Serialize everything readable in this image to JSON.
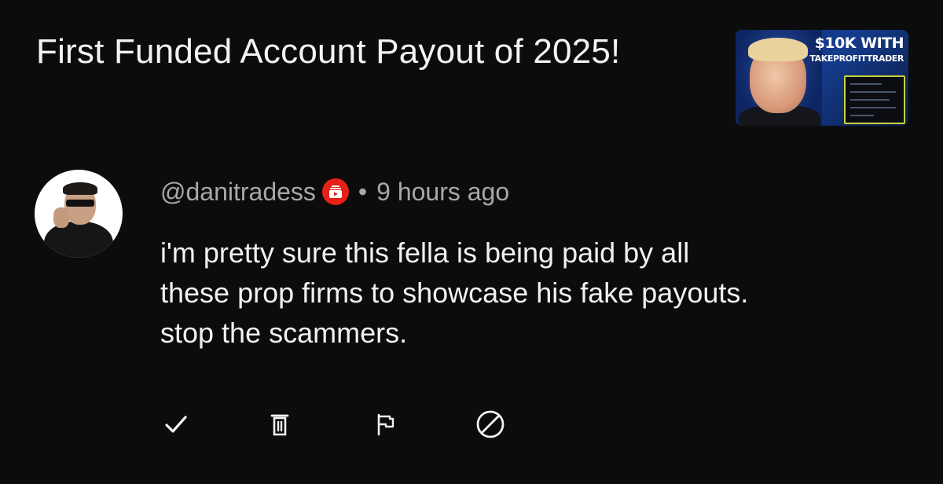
{
  "video": {
    "title": "First Funded Account Payout of 2025!",
    "thumbnail": {
      "headline_line1": "$10K WITH",
      "headline_line2": "TAKEPROFITTRADER"
    }
  },
  "comment": {
    "author_handle": "@danitradess",
    "badge_icon": "red-member-badge-icon",
    "separator": "•",
    "timestamp": "9 hours ago",
    "text_lines": [
      "i'm pretty sure this fella is being paid by all",
      "these prop firms to showcase his fake payouts.",
      "stop the scammers."
    ]
  },
  "actions": [
    {
      "icon": "checkmark-icon"
    },
    {
      "icon": "trash-icon"
    },
    {
      "icon": "flag-icon"
    },
    {
      "icon": "block-icon"
    }
  ],
  "colors": {
    "background": "#0c0c0d",
    "primary_text": "#f1f1f1",
    "secondary_text": "#a8a8a8",
    "badge_red": "#e62117",
    "thumbnail_accent": "#c9d23a"
  }
}
